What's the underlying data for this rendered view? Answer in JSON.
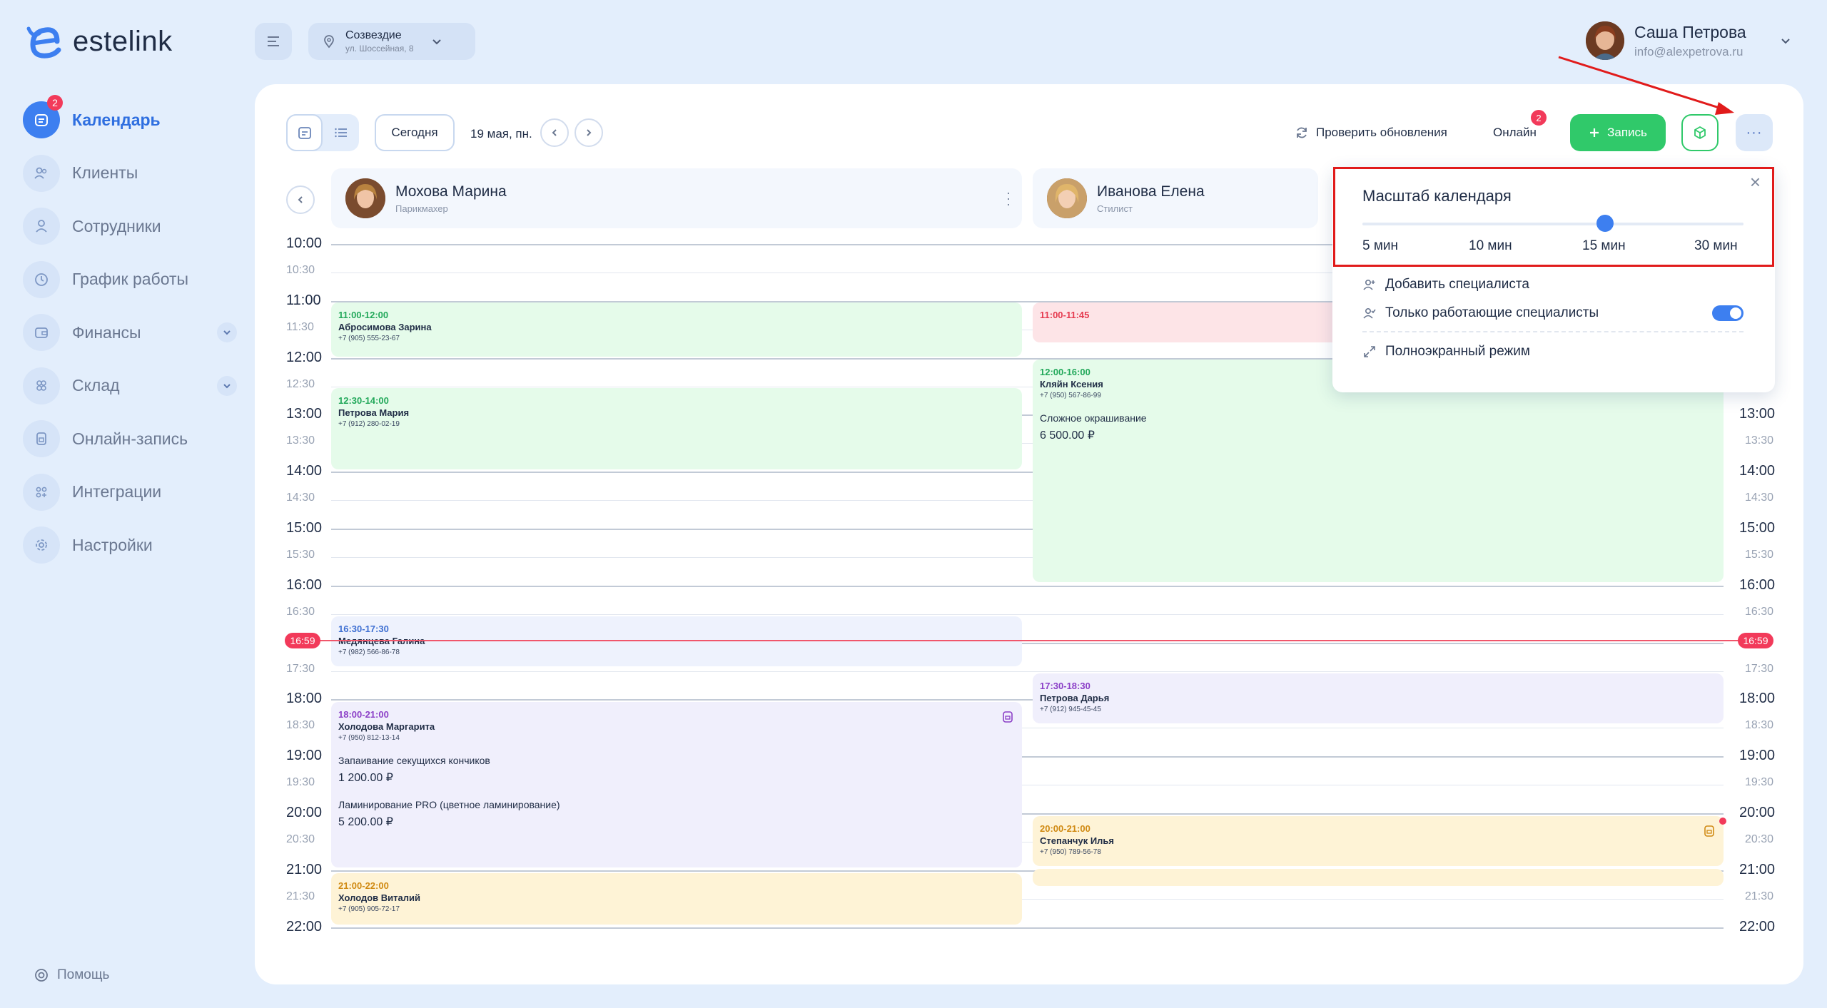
{
  "brand": {
    "logo_text": "estelink"
  },
  "sidebar": {
    "items": [
      {
        "label": "Календарь",
        "icon": "calendar-icon",
        "badge": "2",
        "active": true
      },
      {
        "label": "Клиенты",
        "icon": "clients-icon"
      },
      {
        "label": "Сотрудники",
        "icon": "employee-icon"
      },
      {
        "label": "График работы",
        "icon": "clock-icon"
      },
      {
        "label": "Финансы",
        "icon": "wallet-icon",
        "expandable": true
      },
      {
        "label": "Склад",
        "icon": "warehouse-icon",
        "expandable": true
      },
      {
        "label": "Онлайн-запись",
        "icon": "online-booking-icon"
      },
      {
        "label": "Интеграции",
        "icon": "integrations-icon"
      },
      {
        "label": "Настройки",
        "icon": "settings-icon"
      }
    ],
    "help_label": "Помощь"
  },
  "topbar": {
    "location_name": "Созвездие",
    "location_address": "ул. Шоссейная, 8",
    "user_name": "Саша Петрова",
    "user_email": "info@alexpetrova.ru"
  },
  "toolbar": {
    "today_label": "Сегодня",
    "date_label": "19 мая, пн.",
    "check_updates_label": "Проверить обновления",
    "online_label": "Онлайн",
    "online_badge": "2",
    "new_record_label": "Запись",
    "more_label": "···"
  },
  "specialists": [
    {
      "name": "Мохова Марина",
      "role": "Парикмахер"
    },
    {
      "name": "Иванова Елена",
      "role": "Стилист"
    }
  ],
  "time_slots": [
    "10:00",
    "10:30",
    "11:00",
    "11:30",
    "12:00",
    "12:30",
    "13:00",
    "13:30",
    "14:00",
    "14:30",
    "15:00",
    "15:30",
    "16:00",
    "16:30",
    "17:00",
    "17:30",
    "18:00",
    "18:30",
    "19:00",
    "19:30",
    "20:00",
    "20:30",
    "21:00",
    "21:30",
    "22:00"
  ],
  "current_time": "16:59",
  "events": {
    "col1": [
      {
        "time": "11:00-12:00",
        "client": "Абросимова Зарина",
        "phone": "+7 (905) 555-23-67"
      },
      {
        "time": "12:30-14:00",
        "client": "Петрова Мария",
        "phone": "+7 (912) 280-02-19"
      },
      {
        "time": "16:30-17:30",
        "client": "Медянцева Галина",
        "phone": "+7 (982) 566-86-78"
      },
      {
        "time": "18:00-21:00",
        "client": "Холодова Маргарита",
        "phone": "+7 (950) 812-13-14",
        "service1": "Запаивание секущихся кончиков",
        "price1": "1 200.00 ₽",
        "service2": "Ламинирование PRO (цветное ламинирование)",
        "price2": "5 200.00 ₽"
      },
      {
        "time": "21:00-22:00",
        "client": "Холодов Виталий",
        "phone": "+7 (905) 905-72-17"
      }
    ],
    "col2": [
      {
        "time": "11:00-11:45"
      },
      {
        "time": "12:00-16:00",
        "client": "Кляйн Ксения",
        "phone": "+7 (950) 567-86-99",
        "service1": "Сложное окрашивание",
        "price1": "6 500.00 ₽"
      },
      {
        "time": "17:30-18:30",
        "client": "Петрова Дарья",
        "phone": "+7 (912) 945-45-45"
      },
      {
        "time": "20:00-21:00",
        "client": "Степанчук Илья",
        "phone": "+7 (950) 789-56-78"
      }
    ]
  },
  "scale_popup": {
    "title": "Масштаб календаря",
    "ticks": [
      "5 мин",
      "10 мин",
      "15 мин",
      "30 мин"
    ],
    "selected": "15 мин",
    "add_specialist_label": "Добавить специалиста",
    "only_working_label": "Только работающие специалисты",
    "only_working_enabled": true,
    "fullscreen_label": "Полноэкранный режим"
  },
  "colors": {
    "accent": "#3d7ff0",
    "green": "#30c96a",
    "now": "#f23a5a",
    "annotation": "#e11b1b"
  }
}
